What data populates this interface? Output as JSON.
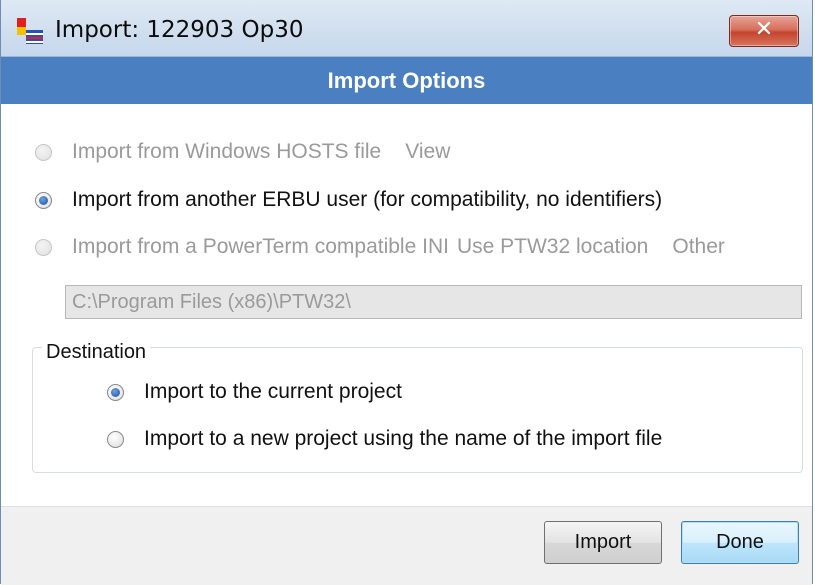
{
  "window": {
    "title": "Import: 122903 Op30",
    "close_glyph": "✕",
    "app_icon": "app-flag-icon"
  },
  "header": {
    "title": "Import Options"
  },
  "options": {
    "hosts": {
      "label": "Import from Windows HOSTS file",
      "view_label": "View",
      "enabled": false,
      "selected": false
    },
    "erbu": {
      "label": "Import from another ERBU user (for compatibility, no identifiers)",
      "enabled": true,
      "selected": true
    },
    "ini": {
      "label": "Import from a PowerTerm compatible INI",
      "use_location_label": "Use PTW32 location",
      "other_label": "Other",
      "enabled": false,
      "selected": false
    },
    "ptw_path": {
      "value": "C:\\Program Files (x86)\\PTW32\\"
    }
  },
  "destination": {
    "legend": "Destination",
    "current_project": {
      "label": "Import to the current project",
      "selected": true
    },
    "new_project": {
      "label": "Import to a new project using the name of the import file",
      "selected": false
    }
  },
  "buttons": {
    "import": "Import",
    "done": "Done"
  },
  "colors": {
    "header_band": "#4a7fc1",
    "disabled_text": "#9a9a9a",
    "close_button": "#c4442d"
  }
}
